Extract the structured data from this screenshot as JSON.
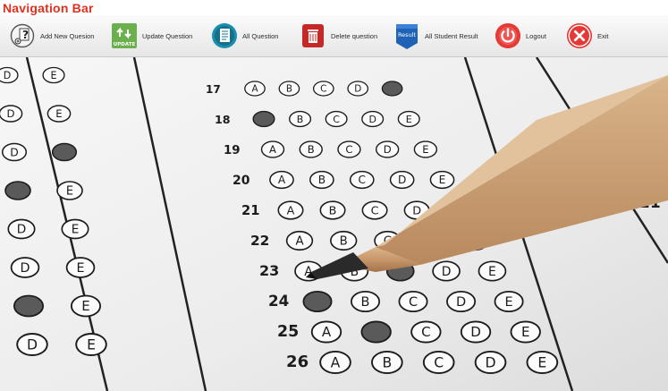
{
  "header": {
    "title": "Navigation Bar"
  },
  "toolbar": {
    "items": [
      {
        "label": "Add New Quesion",
        "icon": "question-icon"
      },
      {
        "label": "Update Question",
        "icon": "update-icon",
        "badge": "UPDATE"
      },
      {
        "label": "All Question",
        "icon": "document-list-icon"
      },
      {
        "label": "Delete question",
        "icon": "trash-icon"
      },
      {
        "label": "All Student Result",
        "icon": "result-icon",
        "badge": "Result"
      },
      {
        "label": "Logout",
        "icon": "power-icon"
      },
      {
        "label": "Exit",
        "icon": "close-icon"
      }
    ]
  },
  "photo": {
    "bubbles": [
      "A",
      "B",
      "C",
      "D",
      "E"
    ],
    "row_numbers": [
      "17",
      "18",
      "19",
      "20",
      "21",
      "22",
      "23",
      "24",
      "25",
      "26"
    ],
    "right_numbers": [
      "21"
    ]
  },
  "colors": {
    "title": "#e0301e",
    "logout": "#e53935",
    "exit": "#e53935",
    "delete": "#c62828",
    "result": "#1e63b5",
    "update": "#6ab04c"
  }
}
